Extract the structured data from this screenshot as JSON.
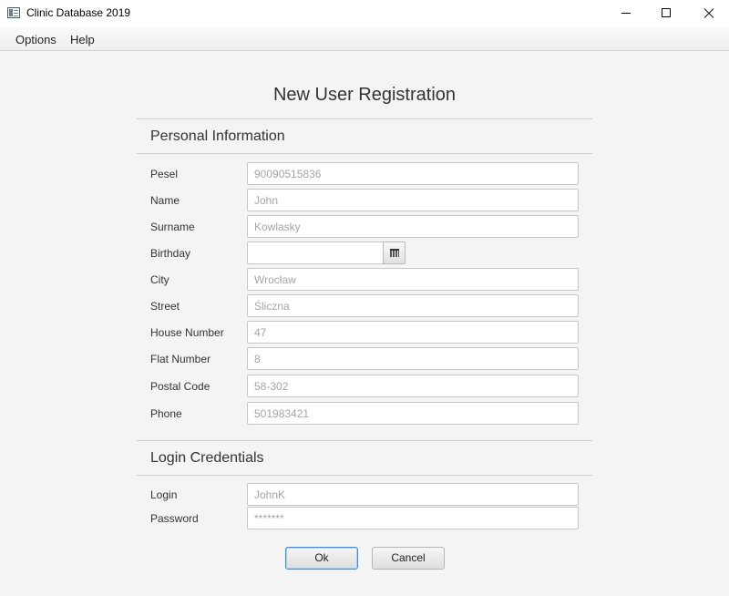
{
  "window": {
    "title": "Clinic Database 2019"
  },
  "menu": {
    "options": "Options",
    "help": "Help"
  },
  "page": {
    "title": "New User Registration"
  },
  "personal": {
    "title": "Personal Information",
    "fields": {
      "pesel": {
        "label": "Pesel",
        "placeholder": "90090515836",
        "value": ""
      },
      "name": {
        "label": "Name",
        "placeholder": "John",
        "value": ""
      },
      "surname": {
        "label": "Surname",
        "placeholder": "Kowlasky",
        "value": ""
      },
      "birthday": {
        "label": "Birthday",
        "placeholder": "",
        "value": ""
      },
      "city": {
        "label": "City",
        "placeholder": "Wrocław",
        "value": ""
      },
      "street": {
        "label": "Street",
        "placeholder": "Śliczna",
        "value": ""
      },
      "house_number": {
        "label": "House Number",
        "placeholder": "47",
        "value": ""
      },
      "flat_number": {
        "label": "Flat Number",
        "placeholder": "8",
        "value": ""
      },
      "postal_code": {
        "label": "Postal Code",
        "placeholder": "58-302",
        "value": ""
      },
      "phone": {
        "label": "Phone",
        "placeholder": "501983421",
        "value": ""
      }
    }
  },
  "login": {
    "title": "Login Credentials",
    "fields": {
      "login": {
        "label": "Login",
        "placeholder": "JohnK",
        "value": ""
      },
      "password": {
        "label": "Password",
        "placeholder": "*******",
        "value": ""
      }
    }
  },
  "buttons": {
    "ok": "Ok",
    "cancel": "Cancel"
  },
  "icons": {
    "app": "app-window-icon",
    "minimize": "minimize-icon",
    "maximize": "maximize-icon",
    "close": "close-icon",
    "calendar": "calendar-icon"
  }
}
